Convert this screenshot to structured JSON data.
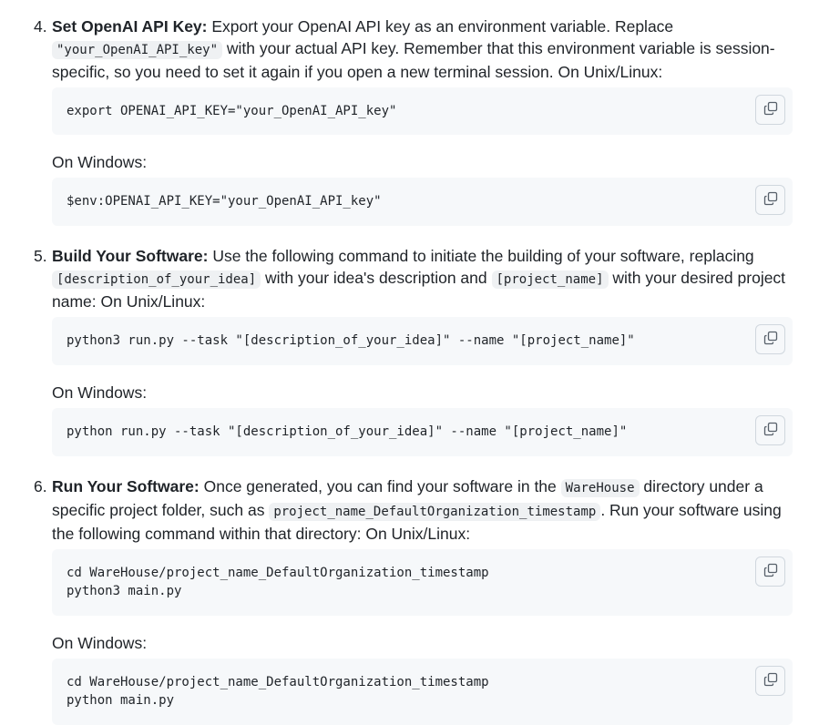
{
  "steps": [
    {
      "number": "4.",
      "title": "Set OpenAI API Key:",
      "text_1": " Export your OpenAI API key as an environment variable. Replace ",
      "inline_code_1": "\"your_OpenAI_API_key\"",
      "text_2": " with your actual API key. Remember that this environment variable is session-specific, so you need to set it again if you open a new terminal session. On Unix/Linux:",
      "code_unix": [
        "export OPENAI_API_KEY=\"your_OpenAI_API_key\""
      ],
      "windows_label": "On Windows:",
      "code_windows": [
        "$env:OPENAI_API_KEY=\"your_OpenAI_API_key\""
      ]
    },
    {
      "number": "5.",
      "title": "Build Your Software:",
      "text_1": " Use the following command to initiate the building of your software, replacing ",
      "inline_code_1": "[description_of_your_idea]",
      "text_2": " with your idea's description and ",
      "inline_code_2": "[project_name]",
      "text_3": " with your desired project name: On Unix/Linux:",
      "code_unix": [
        "python3 run.py --task \"[description_of_your_idea]\" --name \"[project_name]\""
      ],
      "windows_label": "On Windows:",
      "code_windows": [
        "python run.py --task \"[description_of_your_idea]\" --name \"[project_name]\""
      ]
    },
    {
      "number": "6.",
      "title": "Run Your Software:",
      "text_1": " Once generated, you can find your software in the ",
      "inline_code_1": "WareHouse",
      "text_2": " directory under a specific project folder, such as ",
      "inline_code_2": "project_name_DefaultOrganization_timestamp",
      "text_3": ". Run your software using the following command within that directory: On Unix/Linux:",
      "code_unix": [
        "cd WareHouse/project_name_DefaultOrganization_timestamp",
        "python3 main.py"
      ],
      "windows_label": "On Windows:",
      "code_windows": [
        "cd WareHouse/project_name_DefaultOrganization_timestamp",
        "python main.py"
      ]
    }
  ],
  "icons": {
    "copy": "copy-icon"
  }
}
